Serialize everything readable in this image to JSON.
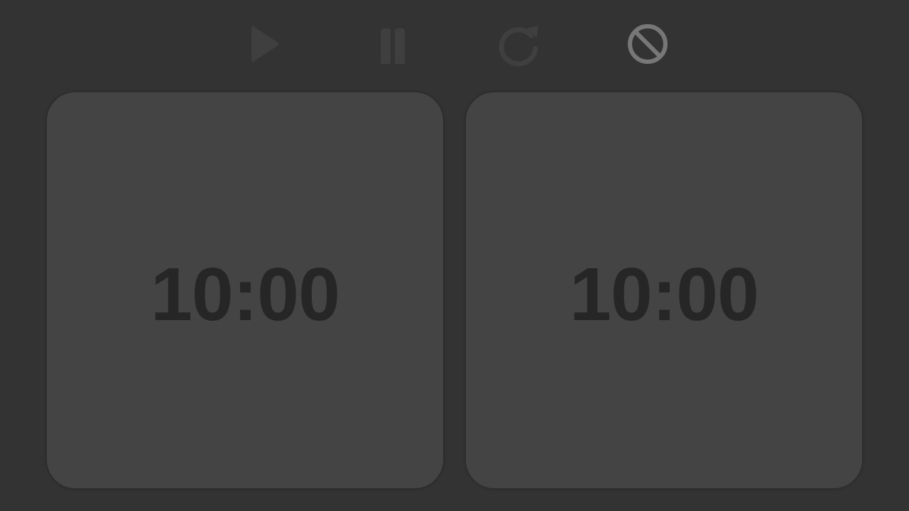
{
  "toolbar": {
    "buttons": [
      {
        "icon": "play-icon",
        "enabled": false,
        "color": "#3f3f3f"
      },
      {
        "icon": "pause-icon",
        "enabled": false,
        "color": "#3f3f3f"
      },
      {
        "icon": "reset-icon",
        "enabled": false,
        "color": "#3f3f3f"
      },
      {
        "icon": "cancel-icon",
        "enabled": true,
        "color": "#777777"
      }
    ]
  },
  "clocks": [
    {
      "time": "10:00"
    },
    {
      "time": "10:00"
    }
  ],
  "colors": {
    "background": "#333333",
    "clock_face": "#444444",
    "clock_text": "#262626"
  }
}
